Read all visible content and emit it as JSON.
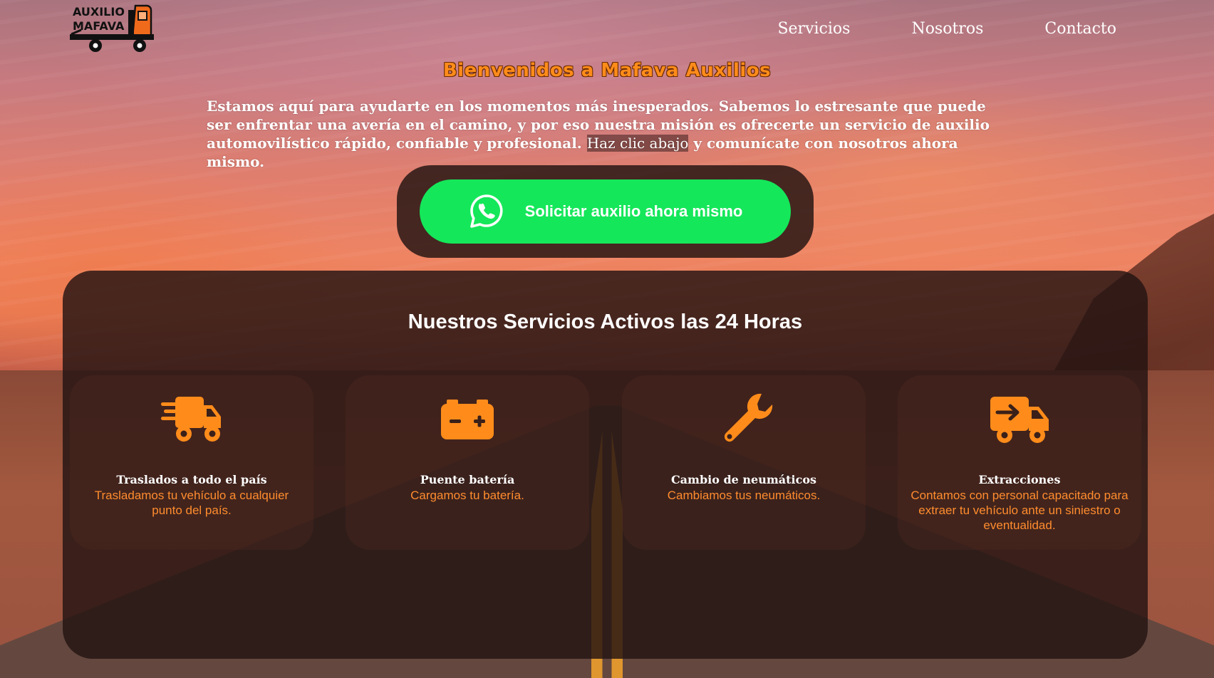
{
  "brand": {
    "logo_line1": "AUXILIO",
    "logo_line2": "MAFAVA"
  },
  "nav": {
    "items": [
      "Servicios",
      "Nosotros",
      "Contacto"
    ]
  },
  "hero": {
    "title": "Bienvenidos a Mafava Auxilios",
    "text_before": "Estamos aquí para ayudarte en los momentos más inesperados. Sabemos lo estresante que puede ser enfrentar una avería en el camino, y por eso nuestra misión es ofrecerte un servicio de auxilio automovilístico rápido, confiable y profesional. ",
    "text_highlight": "Haz clic abajo",
    "text_after": " y comunícate con nosotros ahora mismo.",
    "cta_label": "Solicitar auxilio ahora mismo",
    "cta_icon": "whatsapp-icon"
  },
  "services": {
    "title": "Nuestros Servicios Activos las 24 Horas",
    "items": [
      {
        "icon": "truck-fast-icon",
        "title": "Traslados a todo el país",
        "desc": "Trasladamos tu vehículo a cualquier punto del país."
      },
      {
        "icon": "car-battery-icon",
        "title": "Puente batería",
        "desc": "Cargamos tu batería."
      },
      {
        "icon": "wrench-icon",
        "title": "Cambio de neumáticos",
        "desc": "Cambiamos tus neumáticos."
      },
      {
        "icon": "truck-arrow-right-icon",
        "title": "Extracciones",
        "desc": "Contamos con personal capacitado para extraer tu vehículo ante un siniestro o eventualidad."
      }
    ]
  },
  "colors": {
    "accent_orange": "#ff8c1a",
    "cta_green": "#15e75a",
    "panel_dark": "#23140f"
  }
}
